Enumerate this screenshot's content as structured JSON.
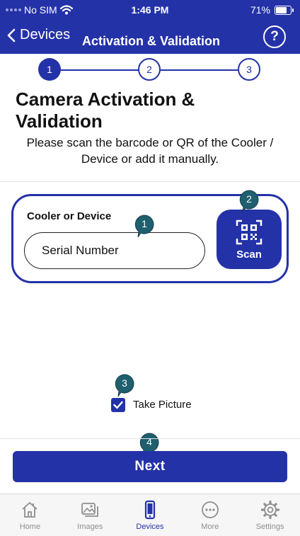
{
  "status_bar": {
    "carrier": "No SIM",
    "time": "1:46 PM",
    "battery": "71%"
  },
  "nav": {
    "back_label": "Devices",
    "title": "Activation & Validation",
    "help_glyph": "?"
  },
  "stepper": {
    "steps": [
      "1",
      "2",
      "3"
    ],
    "current": 1
  },
  "page": {
    "heading": "Camera Activation & Validation",
    "instructions": "Please scan the barcode or QR of the Cooler / Device or add it manually."
  },
  "device_card": {
    "label": "Cooler or Device",
    "serial_placeholder": "Serial Number",
    "scan_label": "Scan"
  },
  "take_picture": {
    "label": "Take Picture",
    "checked": true
  },
  "next_button": {
    "label": "Next"
  },
  "badges": [
    "1",
    "2",
    "3",
    "4"
  ],
  "tabbar": {
    "items": [
      {
        "label": "Home",
        "icon": "home-icon",
        "active": false
      },
      {
        "label": "Images",
        "icon": "images-icon",
        "active": false
      },
      {
        "label": "Devices",
        "icon": "phone-icon",
        "active": true
      },
      {
        "label": "More",
        "icon": "more-icon",
        "active": false
      },
      {
        "label": "Settings",
        "icon": "gear-icon",
        "active": false
      }
    ]
  },
  "colors": {
    "primary": "#2432a8",
    "badge": "#1f5f6e",
    "inactive_tab": "#8e8e8e",
    "background": "#ffffff"
  }
}
